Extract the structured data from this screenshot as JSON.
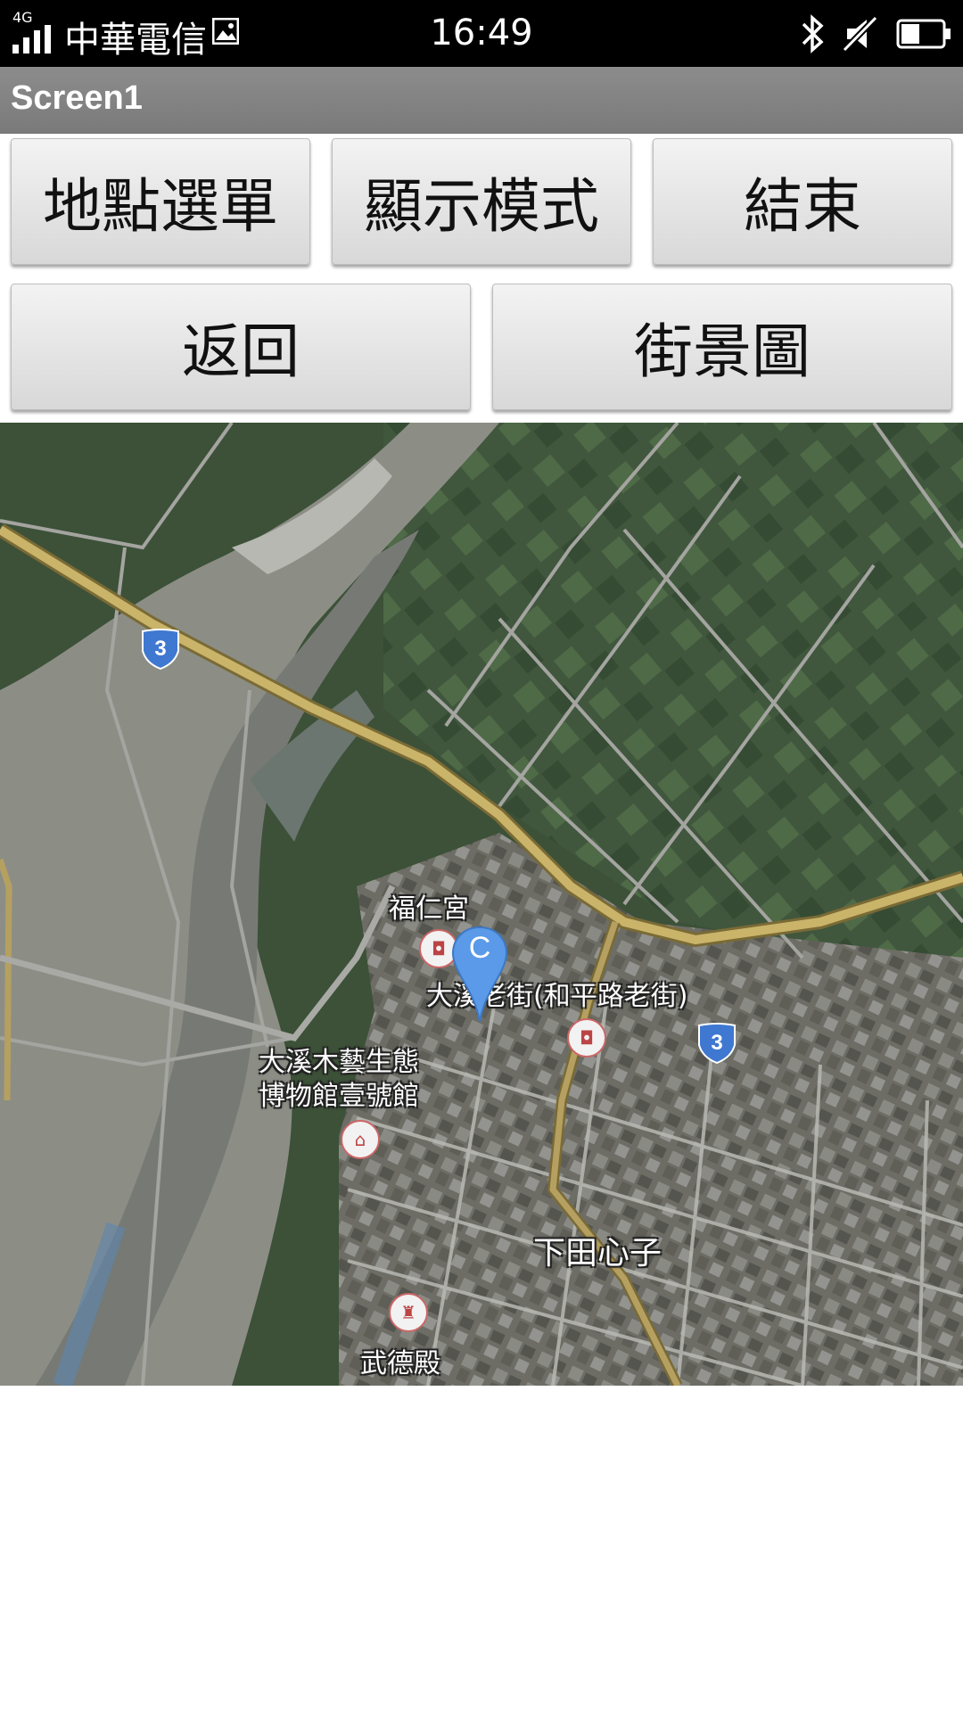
{
  "status_bar": {
    "network": "4G",
    "carrier": "中華電信",
    "time": "16:49",
    "icons": [
      "signal-icon",
      "image-icon",
      "bluetooth-icon",
      "mute-icon",
      "battery-icon"
    ]
  },
  "title_bar": {
    "title": "Screen1"
  },
  "buttons": {
    "location_menu": "地點選單",
    "display_mode": "顯示模式",
    "exit": "結束",
    "back": "返回",
    "street_view": "街景圖"
  },
  "map": {
    "labels": {
      "fuyin_temple": "福仁宮",
      "old_street": "大溪老街(和平路老街)",
      "museum_line1": "大溪木藝生態",
      "museum_line2": "博物館壹號館",
      "xiatian": "下田心子",
      "wude_hall": "武德殿"
    },
    "route_number": "3",
    "marker_label": "C",
    "colors": {
      "road_major": "#c9b46a",
      "road_minor": "#9a9a9a",
      "marker": "#5a9ae8",
      "shield": "#3f78d0"
    }
  }
}
